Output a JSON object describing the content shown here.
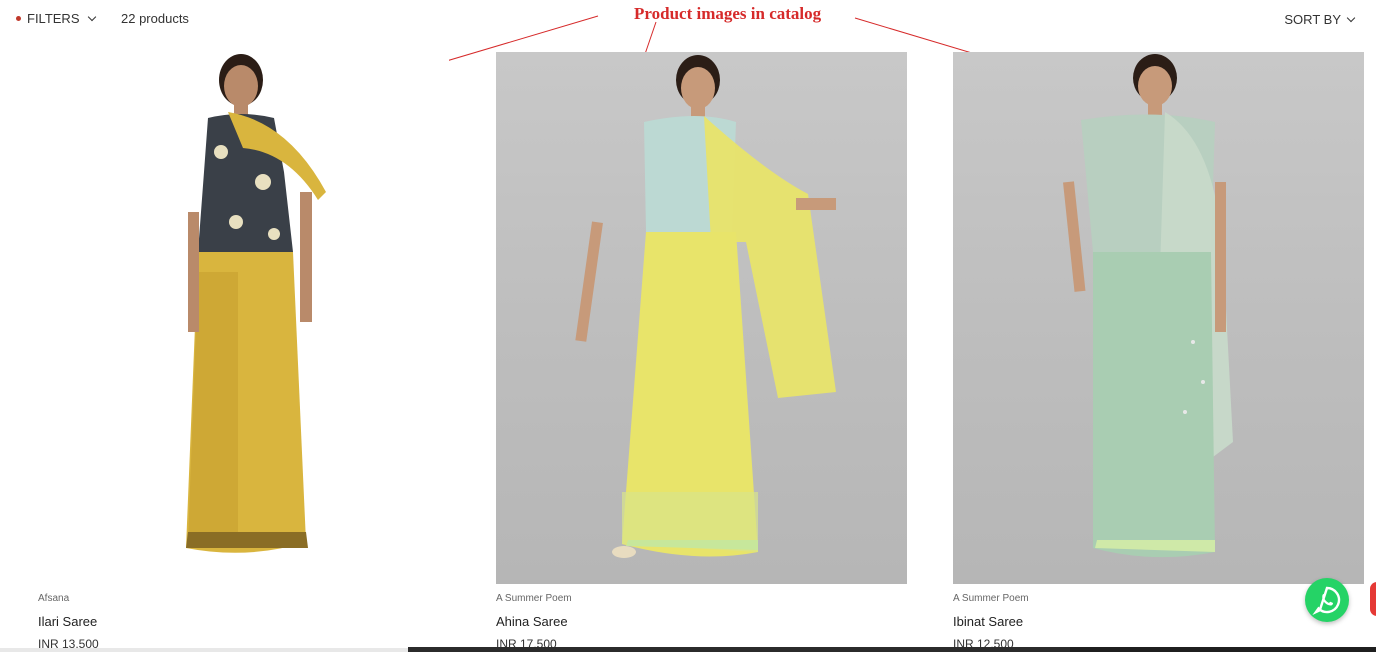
{
  "toolbar": {
    "filters_label": "FILTERS",
    "product_count": "22 products",
    "sort_label": "SORT BY"
  },
  "annotation": {
    "text": "Product images in catalog",
    "color": "#d62a2a"
  },
  "products": [
    {
      "brand": "Afsana",
      "name": "Ilari Saree",
      "price": "INR 13,500",
      "saree_color": "#d9b53e"
    },
    {
      "brand": "A Summer Poem",
      "name": "Ahina Saree",
      "price": "INR 17,500",
      "saree_color": "#e8e46a"
    },
    {
      "brand": "A Summer Poem",
      "name": "Ibinat Saree",
      "price": "INR 12,500",
      "saree_color": "#a9cdb2"
    }
  ],
  "icons": {
    "whatsapp": "whatsapp-icon",
    "filter_dot": "filter-active-dot-icon",
    "chevron": "chevron-down-icon"
  },
  "colors": {
    "accent_red": "#c0392b",
    "whatsapp_green": "#25d366"
  }
}
